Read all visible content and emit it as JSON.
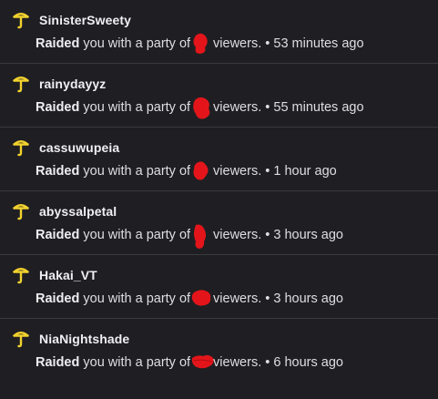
{
  "colors": {
    "background": "#1f1f23",
    "divider": "#3a3a3d",
    "icon": "#f2d22e",
    "redaction": "#e3151a"
  },
  "icons": {
    "raid": "raid-icon"
  },
  "raids": [
    {
      "username": "SinisterSweety",
      "action": "Raided",
      "text_before": "you with a party of",
      "text_after": "viewers.",
      "separator": "•",
      "time": "53 minutes ago"
    },
    {
      "username": "rainydayyz",
      "action": "Raided",
      "text_before": "you with a party of",
      "text_after": "viewers.",
      "separator": "•",
      "time": "55 minutes ago"
    },
    {
      "username": "cassuwupeia",
      "action": "Raided",
      "text_before": "you with a party of",
      "text_after": "viewers.",
      "separator": "•",
      "time": "1 hour ago"
    },
    {
      "username": "abyssalpetal",
      "action": "Raided",
      "text_before": "you with a party of",
      "text_after": "viewers.",
      "separator": "•",
      "time": "3 hours ago"
    },
    {
      "username": "Hakai_VT",
      "action": "Raided",
      "text_before": "you with a party of",
      "text_after": "viewers.",
      "separator": "•",
      "time": "3 hours ago"
    },
    {
      "username": "NiaNightshade",
      "action": "Raided",
      "text_before": "you with a party of",
      "text_after": "viewers.",
      "separator": "•",
      "time": "6 hours ago"
    }
  ]
}
